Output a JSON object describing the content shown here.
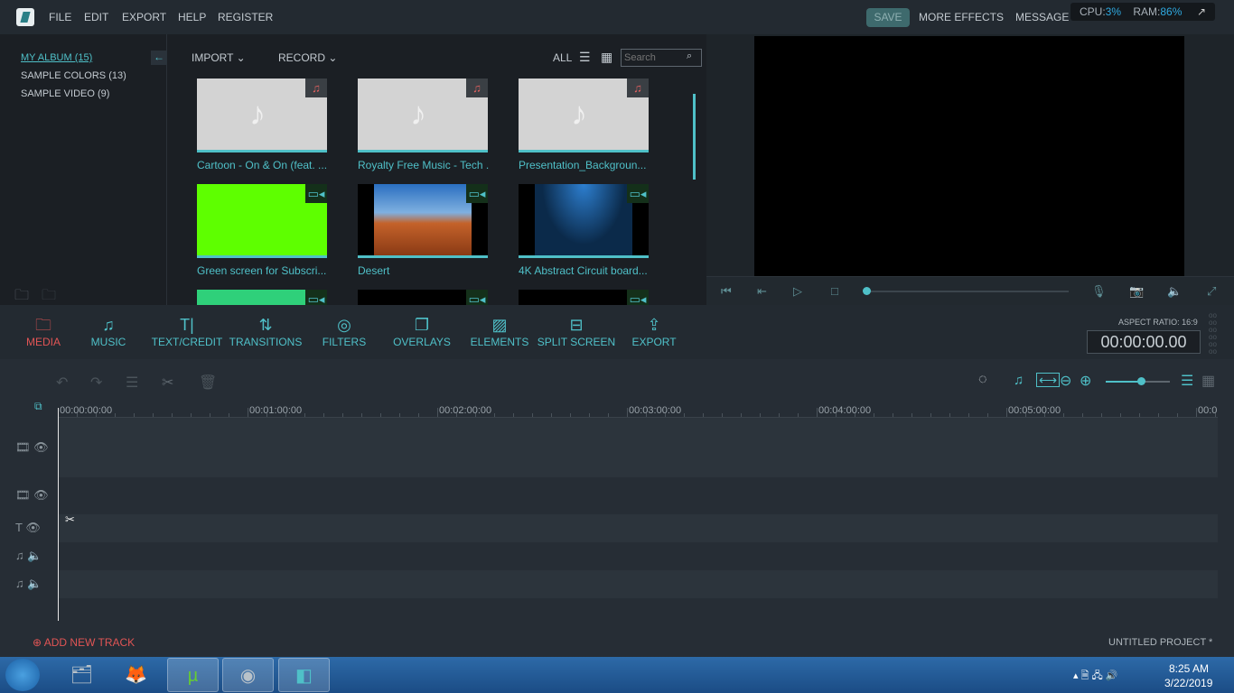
{
  "menu": {
    "items": [
      "FILE",
      "EDIT",
      "EXPORT",
      "HELP",
      "REGISTER"
    ],
    "save": "SAVE",
    "more_effects": "MORE EFFECTS",
    "message": "MESSAGE"
  },
  "perf": {
    "cpu_label": "CPU:",
    "cpu": "3%",
    "ram_label": "RAM:",
    "ram": "86%"
  },
  "album": {
    "items": [
      "MY ALBUM (15)",
      "SAMPLE COLORS (13)",
      "SAMPLE VIDEO (9)"
    ]
  },
  "media": {
    "import": "IMPORT",
    "record": "RECORD",
    "filter": "ALL",
    "search_placeholder": "Search",
    "items": [
      {
        "title": "Cartoon - On & On (feat. ...",
        "type": "audio",
        "thumb": "#d3d3d3"
      },
      {
        "title": "Royalty Free Music - Tech ...",
        "type": "audio",
        "thumb": "#d3d3d3"
      },
      {
        "title": "Presentation_Backgroun...",
        "type": "audio",
        "thumb": "#d3d3d3"
      },
      {
        "title": "Green screen for Subscri...",
        "type": "video",
        "thumb": "#5eff00"
      },
      {
        "title": "Desert",
        "type": "video",
        "thumb": "#c4622a"
      },
      {
        "title": "4K Abstract Circuit board...",
        "type": "video",
        "thumb": "#0b2a4a"
      }
    ]
  },
  "toolbar": {
    "items": [
      {
        "label": "MEDIA",
        "icon": "folder-icon",
        "glyph": "🗀"
      },
      {
        "label": "MUSIC",
        "icon": "music-icon",
        "glyph": "♫"
      },
      {
        "label": "TEXT/CREDIT",
        "icon": "text-icon",
        "glyph": "T|"
      },
      {
        "label": "TRANSITIONS",
        "icon": "transitions-icon",
        "glyph": "⇅"
      },
      {
        "label": "FILTERS",
        "icon": "filters-icon",
        "glyph": "◎"
      },
      {
        "label": "OVERLAYS",
        "icon": "overlays-icon",
        "glyph": "❐"
      },
      {
        "label": "ELEMENTS",
        "icon": "elements-icon",
        "glyph": "▨"
      },
      {
        "label": "SPLIT SCREEN",
        "icon": "split-screen-icon",
        "glyph": "⊟"
      },
      {
        "label": "EXPORT",
        "icon": "export-icon",
        "glyph": "⇪"
      }
    ],
    "active": "MEDIA",
    "aspect_ratio": "ASPECT RATIO: 16:9",
    "timecode": "00:00:00.00"
  },
  "timeline": {
    "ticks": [
      "00:00:00:00",
      "00:01:00:00",
      "00:02:00:00",
      "00:03:00:00",
      "00:04:00:00",
      "00:05:00:00",
      "00:0"
    ],
    "zoom_level": 0.55,
    "add_track": "ADD NEW TRACK",
    "project": "UNTITLED PROJECT *"
  },
  "taskbar": {
    "time": "8:25 AM",
    "date": "3/22/2019"
  }
}
